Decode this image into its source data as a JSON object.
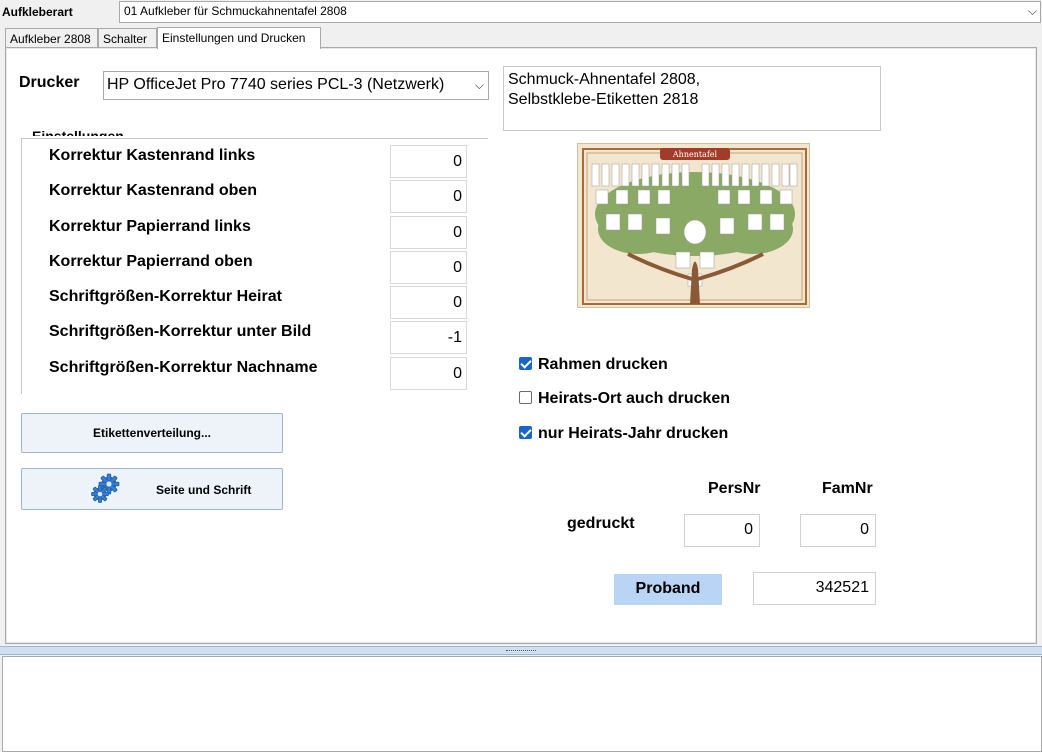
{
  "top": {
    "label": "Aufkleberart",
    "select_value": "01 Aufkleber für Schmuckahnentafel 2808"
  },
  "tabs": [
    {
      "label": "Aufkleber 2808"
    },
    {
      "label": "Schalter"
    },
    {
      "label": "Einstellungen und Drucken"
    }
  ],
  "printer": {
    "label": "Drucker",
    "value": "HP OfficeJet Pro 7740 series PCL-3 (Netzwerk)"
  },
  "description": {
    "line1": "Schmuck-Ahnentafel 2808,",
    "line2": "Selbstklebe-Etiketten 2818"
  },
  "corrections": {
    "group_title": "Einstellungen",
    "items": [
      {
        "label": "Korrektur Kastenrand links",
        "value": "0"
      },
      {
        "label": "Korrektur Kastenrand oben",
        "value": "0"
      },
      {
        "label": "Korrektur Papierrand links",
        "value": "0"
      },
      {
        "label": "Korrektur Papierrand oben",
        "value": "0"
      },
      {
        "label": "Schriftgrößen-Korrektur Heirat",
        "value": "0"
      },
      {
        "label": "Schriftgrößen-Korrektur unter Bild",
        "value": "-1"
      },
      {
        "label": "Schriftgrößen-Korrektur Nachname",
        "value": "0"
      }
    ]
  },
  "buttons": {
    "etiketten": "Etikettenverteilung...",
    "seite": "Seite und Schrift",
    "proband": "Proband"
  },
  "image": {
    "title": "Ahnentafel"
  },
  "options": [
    {
      "label": "Rahmen drucken",
      "checked": true
    },
    {
      "label": "Heirats-Ort auch drucken",
      "checked": false
    },
    {
      "label": "nur Heirats-Jahr drucken",
      "checked": true
    }
  ],
  "counters": {
    "col_pers": "PersNr",
    "col_fam": "FamNr",
    "row_label": "gedruckt",
    "pers_value": "0",
    "fam_value": "0"
  },
  "proband": {
    "value": "342521"
  },
  "colors": {
    "accent": "#1a65c8",
    "proband_bg": "#b9d4f5",
    "splitter": "#cfe0f1"
  },
  "icons": {
    "gear": "gear-icon",
    "dropdown": "chevron-down-icon"
  }
}
